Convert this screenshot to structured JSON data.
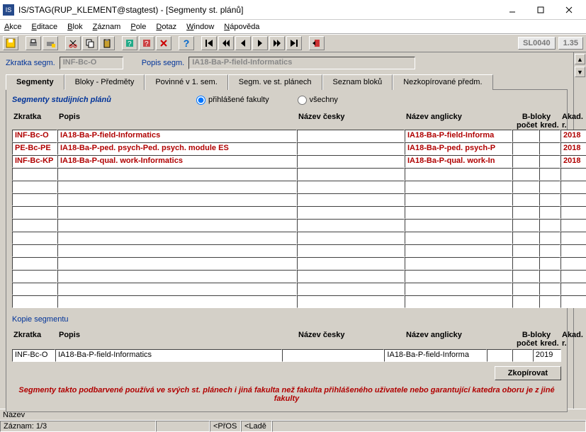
{
  "window": {
    "title": "IS/STAG(RUP_KLEMENT@stagtest) - [Segmenty st. plánů]",
    "icon_text": "IS"
  },
  "menu": {
    "akce": "Akce",
    "editace": "Editace",
    "blok": "Blok",
    "zaznam": "Záznam",
    "pole": "Pole",
    "dotaz": "Dotaz",
    "window": "Window",
    "napoveda": "Nápověda"
  },
  "toolbar_right": {
    "code": "SL0040",
    "ver": "1.35"
  },
  "header": {
    "zkratka_lbl": "Zkratka segm.",
    "zkratka_val": "INF-Bc-O",
    "popis_lbl": "Popis segm.",
    "popis_val": "IA18-Ba-P-field-Informatics"
  },
  "tabs": {
    "segmenty": "Segmenty",
    "bloky": "Bloky - Předměty",
    "povinne": "Povinné v 1. sem.",
    "segm_ve": "Segm. ve st. plánech",
    "seznam": "Seznam bloků",
    "nezkop": "Nezkopírované předm."
  },
  "section_title": "Segmenty studijních plánů",
  "radio": {
    "prihlasene": "přihlášené fakulty",
    "vsechny": "všechny"
  },
  "grid": {
    "hdr_zkratka": "Zkratka",
    "hdr_popis": "Popis",
    "hdr_nazev_c": "Název česky",
    "hdr_nazev_a": "Název anglicky",
    "hdr_bbloky": "B-bloky",
    "hdr_pocet": "počet",
    "hdr_kred": "kred.",
    "hdr_akad": "Akad. r.",
    "rows": [
      {
        "zk": "INF-Bc-O",
        "po": "IA18-Ba-P-field-Informatics",
        "nc": "",
        "na": "IA18-Ba-P-field-Informa",
        "b1": "",
        "b2": "",
        "ak": "2018"
      },
      {
        "zk": "PE-Bc-PE",
        "po": "IA18-Ba-P-ped. psych-Ped. psych. module ES",
        "nc": "",
        "na": "IA18-Ba-P-ped. psych-P",
        "b1": "",
        "b2": "",
        "ak": "2018"
      },
      {
        "zk": "INF-Bc-KP",
        "po": "IA18-Ba-P-qual. work-Informatics",
        "nc": "",
        "na": "IA18-Ba-P-qual. work-In",
        "b1": "",
        "b2": "",
        "ak": "2018"
      }
    ]
  },
  "kopie": {
    "title": "Kopie segmentu",
    "hdr_zkratka": "Zkratka",
    "hdr_popis": "Popis",
    "hdr_nazev_c": "Název česky",
    "hdr_nazev_a": "Název anglicky",
    "hdr_bbloky": "B-bloky",
    "hdr_pocet": "počet",
    "hdr_kred": "kred.",
    "hdr_akad": "Akad. r.",
    "zk": "INF-Bc-O",
    "po": "IA18-Ba-P-field-Informatics",
    "nc": "",
    "na": "IA18-Ba-P-field-Informa",
    "b1": "",
    "b2": "",
    "ak": "2019",
    "btn": "Zkopírovat"
  },
  "footer_note": "Segmenty takto podbarvené používá ve svých st. plánech i jiná fakulta než fakulta přihlášeného uživatele nebo garantující katedra oboru je z jiné fakulty",
  "status": {
    "nazev_lbl": "Název",
    "zaznam": "Záznam: 1/3",
    "c1": "",
    "c2": "<PřOS",
    "c3": "<Ladě"
  },
  "empty_rows": 11
}
